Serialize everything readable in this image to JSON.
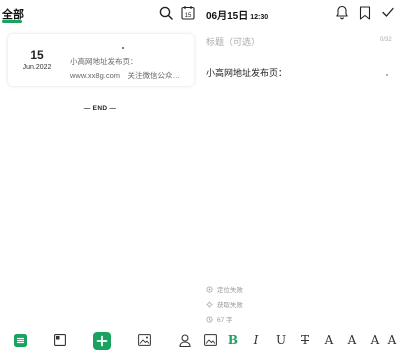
{
  "colors": {
    "accent": "#1aa260",
    "text": "#222222",
    "muted": "#999999",
    "placeholder": "#aaaaaa"
  },
  "left": {
    "tab_label": "全部",
    "icons": [
      "search-icon",
      "calendar-icon"
    ],
    "calendar_day": "15",
    "note": {
      "day": "15",
      "month_year": "Jun.2022",
      "line1": "小高网地址发布页：",
      "line2": "www.xx8g.com　关注微信公众…"
    },
    "end_label": "— END —"
  },
  "right": {
    "date": "06月15日",
    "time": "12:30",
    "icons": [
      "bell-icon",
      "bookmark-icon",
      "check-icon"
    ],
    "title_placeholder": "标题（可选）",
    "title_counter": "0/32",
    "content": "小高网地址发布页：",
    "status": {
      "location": "定位失败",
      "fetch": "获取失败",
      "word_count": "67 字"
    }
  },
  "toolbar": {
    "bold": "B",
    "italic": "I",
    "underline": "U",
    "strike": "T",
    "font_a1": "A",
    "font_a2": "A",
    "font_a3": "A",
    "font_a4": "A"
  }
}
